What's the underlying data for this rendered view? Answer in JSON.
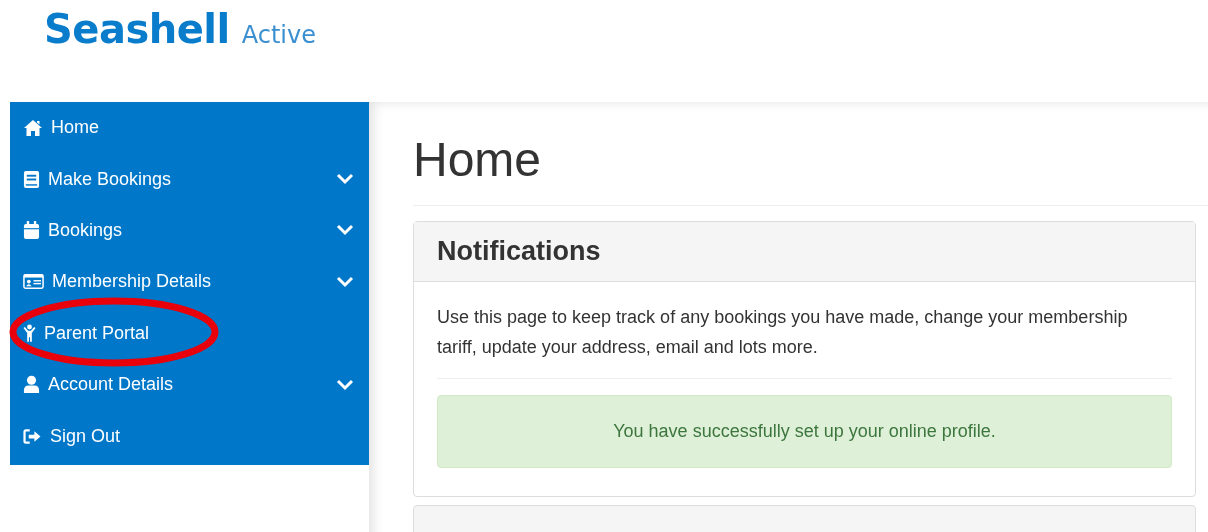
{
  "logo": {
    "brand": "Seashell",
    "suffix": "Active"
  },
  "sidebar": {
    "items": [
      {
        "label": "Home",
        "expandable": false,
        "circled": false
      },
      {
        "label": "Make Bookings",
        "expandable": true,
        "circled": false
      },
      {
        "label": "Bookings",
        "expandable": true,
        "circled": false
      },
      {
        "label": "Membership Details",
        "expandable": true,
        "circled": false
      },
      {
        "label": "Parent Portal",
        "expandable": false,
        "circled": true
      },
      {
        "label": "Account Details",
        "expandable": true,
        "circled": false
      },
      {
        "label": "Sign Out",
        "expandable": false,
        "circled": false
      }
    ]
  },
  "page_title": "Home",
  "panel": {
    "title": "Notifications",
    "text": "Use this page to keep track of any bookings you have made, change your membership tariff, update your address, email and lots more.",
    "alert": "You have successfully set up your online profile."
  }
}
